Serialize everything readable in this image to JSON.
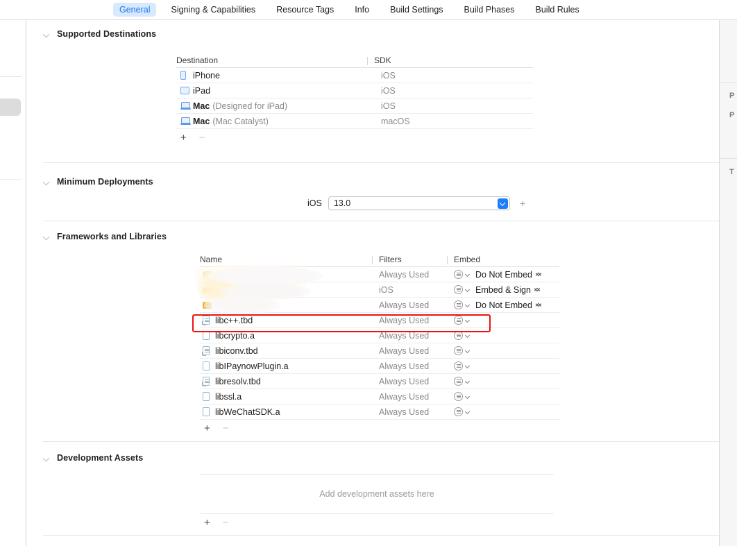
{
  "tabs": [
    {
      "label": "General",
      "active": true
    },
    {
      "label": "Signing & Capabilities",
      "active": false
    },
    {
      "label": "Resource Tags",
      "active": false
    },
    {
      "label": "Info",
      "active": false
    },
    {
      "label": "Build Settings",
      "active": false
    },
    {
      "label": "Build Phases",
      "active": false
    },
    {
      "label": "Build Rules",
      "active": false
    }
  ],
  "sections": {
    "supported_destinations": {
      "title": "Supported Destinations",
      "columns": [
        "Destination",
        "SDK"
      ],
      "rows": [
        {
          "icon": "iphone-icon",
          "name": "iPhone",
          "note": "",
          "sdk": "iOS"
        },
        {
          "icon": "ipad-icon",
          "name": "iPad",
          "note": "",
          "sdk": "iOS"
        },
        {
          "icon": "mac-icon",
          "name": "Mac",
          "note": "(Designed for iPad)",
          "sdk": "iOS"
        },
        {
          "icon": "mac-icon",
          "name": "Mac",
          "note": "(Mac Catalyst)",
          "sdk": "macOS"
        }
      ],
      "add_label": "+",
      "remove_label": "−"
    },
    "minimum_deployments": {
      "title": "Minimum Deployments",
      "platform_label": "iOS",
      "value": "13.0",
      "add_label": "+"
    },
    "frameworks_and_libraries": {
      "title": "Frameworks and Libraries",
      "columns": [
        "Name",
        "Filters",
        "Embed"
      ],
      "rows": [
        {
          "icon": "framework-icon",
          "name": "",
          "redacted": true,
          "filters": "Always Used",
          "embed": "Do Not Embed"
        },
        {
          "icon": "framework-icon",
          "name": "",
          "redacted": true,
          "filters": "iOS",
          "embed": "Embed & Sign"
        },
        {
          "icon": "framework-icon",
          "name": "",
          "redacted": true,
          "filters": "Always Used",
          "embed": "Do Not Embed"
        },
        {
          "icon": "tbd-icon",
          "name": "libc++.tbd",
          "redacted": false,
          "filters": "Always Used",
          "embed": "",
          "highlighted": true
        },
        {
          "icon": "archive-icon",
          "name": "libcrypto.a",
          "redacted": false,
          "filters": "Always Used",
          "embed": ""
        },
        {
          "icon": "tbd-icon",
          "name": "libiconv.tbd",
          "redacted": false,
          "filters": "Always Used",
          "embed": ""
        },
        {
          "icon": "archive-icon",
          "name": "libIPaynowPlugin.a",
          "redacted": false,
          "filters": "Always Used",
          "embed": ""
        },
        {
          "icon": "tbd-icon",
          "name": "libresolv.tbd",
          "redacted": false,
          "filters": "Always Used",
          "embed": ""
        },
        {
          "icon": "archive-icon",
          "name": "libssl.a",
          "redacted": false,
          "filters": "Always Used",
          "embed": ""
        },
        {
          "icon": "archive-icon",
          "name": "libWeChatSDK.a",
          "redacted": false,
          "filters": "Always Used",
          "embed": ""
        }
      ],
      "add_label": "+",
      "remove_label": "−"
    },
    "development_assets": {
      "title": "Development Assets",
      "empty_text": "Add development assets here",
      "add_label": "+",
      "remove_label": "−"
    }
  },
  "inspector": {
    "fragments": [
      "P",
      "P",
      "T"
    ]
  },
  "colors": {
    "accent": "#1c7ced",
    "tab_active_bg": "#d8e8fd",
    "highlight": "#ee1111",
    "dropdown_blue": "#1d7dfb"
  }
}
